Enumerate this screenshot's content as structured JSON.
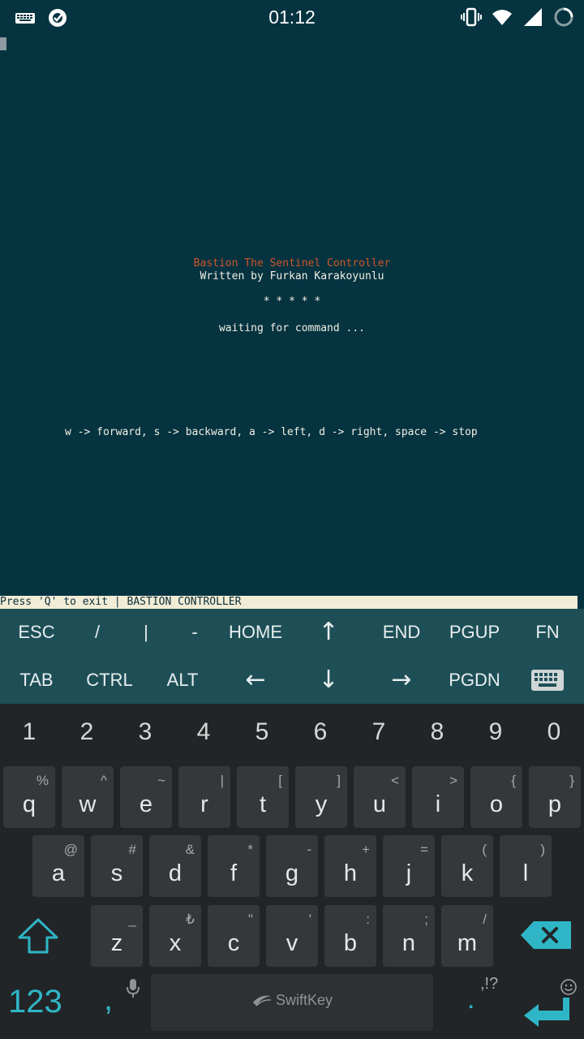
{
  "status_bar": {
    "time": "01:12",
    "left_icons": [
      "keyboard-icon",
      "app-notification-icon"
    ],
    "right_icons": [
      "vibrate-icon",
      "wifi-icon",
      "signal-icon",
      "battery-icon"
    ]
  },
  "terminal": {
    "title": "Bastion The Sentinel Controller",
    "author": "Written by Furkan Karakoyunlu",
    "stars": "* * * * *",
    "waiting": "waiting for command ...",
    "controls": "w -> forward, s -> backward, a -> left, d -> right, space -> stop",
    "status_line": "Press 'Q' to exit | BASTION CONTROLLER",
    "colors": {
      "background": "#053340",
      "title": "#d0542a",
      "text": "#f2f0e4"
    }
  },
  "extra_keys": {
    "row1": [
      "ESC",
      "/",
      "|",
      "-",
      "HOME",
      "↑",
      "END",
      "PGUP",
      "FN"
    ],
    "row2": [
      "TAB",
      "CTRL",
      "ALT",
      "←",
      "↓",
      "→",
      "PGDN"
    ],
    "keyboard_toggle_icon": "keyboard-icon"
  },
  "keyboard": {
    "numbers": [
      "1",
      "2",
      "3",
      "4",
      "5",
      "6",
      "7",
      "8",
      "9",
      "0"
    ],
    "row1": [
      {
        "main": "q",
        "sub": "%"
      },
      {
        "main": "w",
        "sub": "^"
      },
      {
        "main": "e",
        "sub": "~"
      },
      {
        "main": "r",
        "sub": "|"
      },
      {
        "main": "t",
        "sub": "["
      },
      {
        "main": "y",
        "sub": "]"
      },
      {
        "main": "u",
        "sub": "<"
      },
      {
        "main": "i",
        "sub": ">"
      },
      {
        "main": "o",
        "sub": "{"
      },
      {
        "main": "p",
        "sub": "}"
      }
    ],
    "row2": [
      {
        "main": "a",
        "sub": "@"
      },
      {
        "main": "s",
        "sub": "#"
      },
      {
        "main": "d",
        "sub": "&"
      },
      {
        "main": "f",
        "sub": "*"
      },
      {
        "main": "g",
        "sub": "-"
      },
      {
        "main": "h",
        "sub": "+"
      },
      {
        "main": "j",
        "sub": "="
      },
      {
        "main": "k",
        "sub": "("
      },
      {
        "main": "l",
        "sub": ")"
      }
    ],
    "row3": [
      {
        "main": "z",
        "sub": "_"
      },
      {
        "main": "x",
        "sub": "₺"
      },
      {
        "main": "c",
        "sub": "\""
      },
      {
        "main": "v",
        "sub": "'"
      },
      {
        "main": "b",
        "sub": ":"
      },
      {
        "main": "n",
        "sub": ";"
      },
      {
        "main": "m",
        "sub": "/"
      }
    ],
    "mode_key": "123",
    "comma_key": ",",
    "space_brand": "SwiftKey",
    "period_key": ".",
    "period_sub": ",!?",
    "accent_color": "#2fb6c6"
  }
}
